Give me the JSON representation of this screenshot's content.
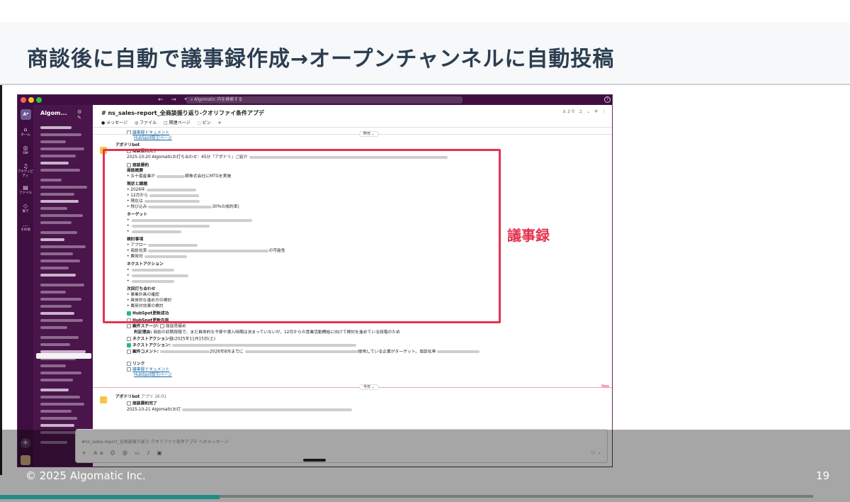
{
  "slide": {
    "title": "商談後に自動で議事録作成→オープンチャンネルに自動投稿",
    "annotation": "議事録",
    "footer_copyright": "© 2025 Algomatic Inc.",
    "page_number": "19"
  },
  "video": {
    "progress_fraction": 0.27
  },
  "slack": {
    "workspace_badge": "A*",
    "workspace_name": "Algom...",
    "search_placeholder": "Algomatic 内を検索する",
    "rail": [
      {
        "icon": "⌂",
        "label": "ホーム"
      },
      {
        "icon": "◎",
        "label": "DM"
      },
      {
        "icon": "♫",
        "label": "アクティビティ"
      },
      {
        "icon": "▤",
        "label": "ファイル"
      },
      {
        "icon": "◇",
        "label": "後で"
      },
      {
        "icon": "…",
        "label": "その他"
      }
    ],
    "channel": {
      "name": "# ns_sales-report_全商談振り返り-クオリファイ条件アプデ",
      "tabs": [
        "● メッセージ",
        "◎ ファイル",
        "▢ 関連ページ",
        "◌ ピン",
        "+"
      ],
      "member_count": "20"
    },
    "earlier_links": [
      "議事録ドキュメント",
      "HubSpot取引ページ"
    ],
    "date_pill_1": "昨日 ⌄",
    "msg1": {
      "sender": "アポドリbot",
      "summary_title": "商談要約完了",
      "meeting_line": "2025-10-20 Algomaticお打ち合わせ：45分「アポドリ」ご紹介",
      "section_summary_icon_title": "商談要約",
      "overview_title": "商談概要",
      "overview_line": "• 五十嵐産業が",
      "overview_tail": "様株式会社にMTGを実施",
      "current_title": "現状と課題",
      "current_lines": [
        "• 2026年",
        "• 12月から",
        "• 現在は",
        "• 飛び込み"
      ],
      "current_tail": "30%の成約率)",
      "target_title": "ターゲット",
      "discussion_title": "検討事項",
      "discussion_lines": [
        "• アプロー",
        "• 商談化率",
        "• 費用対"
      ],
      "discussion_tail": "の可能性",
      "next_title": "ネクストアクション",
      "followup_title": "次回打ち合わせ",
      "followup_lines": [
        "• 事業計画の確認",
        "• 具体的な進め方の検討",
        "• 費用対効果の検討"
      ],
      "hubspot_done": "HubSpot更新成功",
      "hubspot_changes": "HubSpot更新内容",
      "stage_label": "案件ステージ:",
      "stage_value": "商談見極め",
      "reason_label": "判定理由:",
      "reason_value": "商談の初期段階で、まだ具体的な予算や導入時期は決まっていないが、12月からの営業活動開始に向けて検討を進めている段階のため",
      "next_date_label": "ネクストアクション日:",
      "next_date_value": "2025年11月15日(土)",
      "next_action_label": "ネクストアクション:",
      "deal_comment_label": "案件コメント:",
      "deal_comment_mid": "2026年8月までに",
      "deal_comment_tail": "使用している企業がターゲット。商談化率",
      "link_title": "リンク",
      "links": [
        "議事録ドキュメント",
        "HubSpot取引ページ"
      ]
    },
    "date_pill_today": "今日 ⌄",
    "new_label": "New",
    "msg2": {
      "sender": "アポドリbot",
      "app_badge": "アプリ",
      "time": "16:01",
      "summary_title": "商談要約完了",
      "meeting_line": "2025-10-21 Algomaticお打"
    },
    "composer_placeholder": "#ns_sales-report_全商談振り返り-クオリファイ条件アプデ へのメッセージ"
  }
}
